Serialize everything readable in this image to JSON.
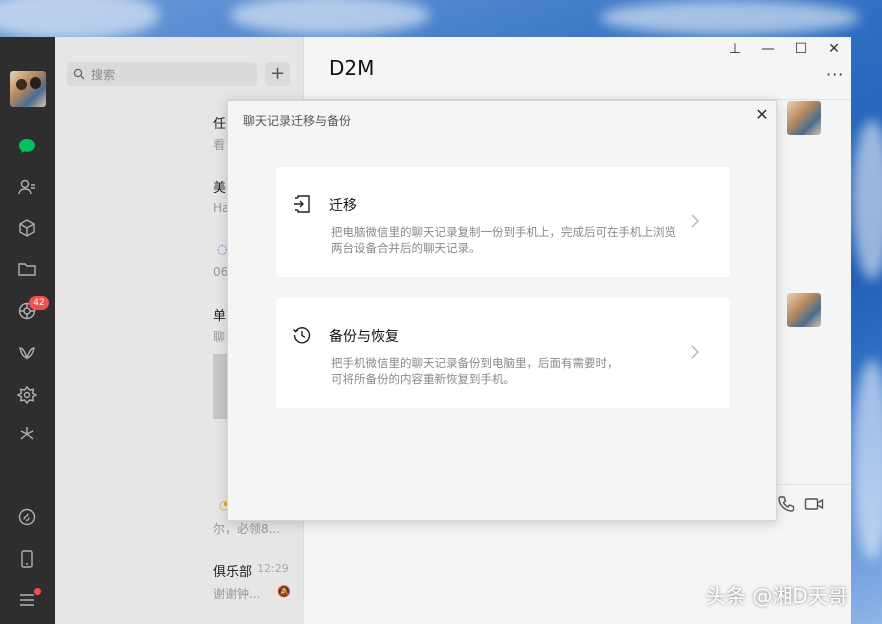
{
  "nav": {
    "badge_count": "42"
  },
  "search": {
    "placeholder": "搜索",
    "add_label": "+"
  },
  "chat_list": {
    "items": [
      {
        "title": "任",
        "sub": "看"
      },
      {
        "title": "美.",
        "sub": "Ha"
      },
      {
        "title": "",
        "sub": "06"
      },
      {
        "title": "单",
        "sub": "聊"
      },
      {
        "title": "",
        "sub": "尔，必领8..."
      },
      {
        "title": "俱乐部",
        "sub": "谢谢钟...",
        "time": "12:29"
      }
    ]
  },
  "chat": {
    "title": "D2M",
    "more": "···"
  },
  "window_controls": {
    "pin": "⊥",
    "minimize": "—",
    "maximize": "☐",
    "close": "✕"
  },
  "modal": {
    "title": "聊天记录迁移与备份",
    "close": "✕",
    "options": [
      {
        "icon": "migrate-icon",
        "title": "迁移",
        "desc": "把电脑微信里的聊天记录复制一份到手机上，完成后可在手机上浏览两台设备合并后的聊天记录。"
      },
      {
        "icon": "history-icon",
        "title": "备份与恢复",
        "desc_line1": "把手机微信里的聊天记录备份到电脑里，后面有需要时，",
        "desc_line2": "可将所备份的内容重新恢复到手机。"
      }
    ]
  },
  "watermark": "头条 @湘D天哥",
  "colors": {
    "nav_bg": "#2e2e2e",
    "wechat_green": "#07c160",
    "badge_red": "#f25050"
  }
}
